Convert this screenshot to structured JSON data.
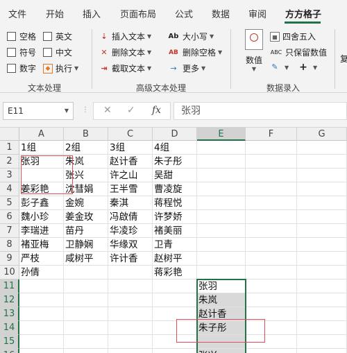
{
  "ribbon_tabs": [
    "文件",
    "开始",
    "插入",
    "页面布局",
    "公式",
    "数据",
    "审阅",
    "方方格子"
  ],
  "active_tab": "方方格子",
  "text_group": {
    "label": "文本处理",
    "checks": [
      "空格",
      "英文",
      "符号",
      "中文",
      "数字"
    ],
    "execute": "执行"
  },
  "advanced_group": {
    "label": "高级文本处理",
    "insert_text": "插入文本",
    "delete_text": "删除文本",
    "extract_text": "截取文本",
    "case": "大小写",
    "delete_spaces": "删除空格",
    "more": "更多"
  },
  "entry_group": {
    "label": "数据录入",
    "value": "数值",
    "round": "四舍五入",
    "keep_value": "只保留数值",
    "abc": "ABC",
    "truncated": "复"
  },
  "formula_bar": {
    "name_box": "E11",
    "cancel": "✕",
    "enter": "✓",
    "fx": "fx",
    "value": "张羽"
  },
  "columns": [
    "A",
    "B",
    "C",
    "D",
    "E",
    "F",
    "G"
  ],
  "rows": [
    "1",
    "2",
    "3",
    "4",
    "5",
    "6",
    "7",
    "8",
    "9",
    "10",
    "11",
    "12",
    "13",
    "14",
    "15",
    "16"
  ],
  "sheet": {
    "A": [
      "1组",
      "张羽",
      "",
      "姜彩艳",
      "彭子鑫",
      "魏小珍",
      "李瑞进",
      "褚亚梅",
      "严枝",
      "孙倩"
    ],
    "B": [
      "2组",
      "朱岚",
      "张兴",
      "沈彗娟",
      "金婉",
      "姜金玫",
      "苗丹",
      "卫静娴",
      "咸树平",
      ""
    ],
    "C": [
      "3组",
      "赵计香",
      "许之山",
      "王半雪",
      "秦淇",
      "冯啟倩",
      "华凌珍",
      "华缘双",
      "许计香",
      ""
    ],
    "D": [
      "4组",
      "朱子彤",
      "吴甜",
      "曹凌旋",
      "蒋程悦",
      "许梦娇",
      "褚美丽",
      "卫青",
      "赵树平",
      "蒋彩艳"
    ]
  },
  "column_e": [
    "张羽",
    "朱岚",
    "赵计香",
    "朱子彤",
    "",
    "张兴"
  ]
}
